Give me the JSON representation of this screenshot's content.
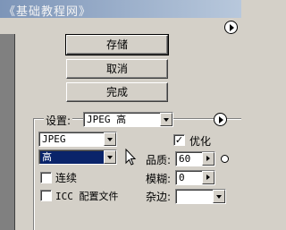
{
  "window": {
    "title": "《基础教程网》"
  },
  "buttons": {
    "save": "存储",
    "cancel": "取消",
    "done": "完成"
  },
  "settings": {
    "label": "设置:",
    "preset_value": "JPEG 高",
    "format_value": "JPEG",
    "quality_level_value": "高",
    "optimize_label": "优化",
    "optimize_checked": true,
    "progressive_label": "连续",
    "progressive_checked": false,
    "icc_label": "ICC 配置文件",
    "icc_checked": false,
    "quality_label": "品质:",
    "quality_value": "60",
    "blur_label": "模糊:",
    "blur_value": "0",
    "matte_label": "杂边:",
    "matte_value": ""
  },
  "icons": {
    "top_menu": "flyout-menu-icon",
    "settings_menu": "flyout-menu-icon",
    "cursor": "mouse-cursor-icon"
  }
}
